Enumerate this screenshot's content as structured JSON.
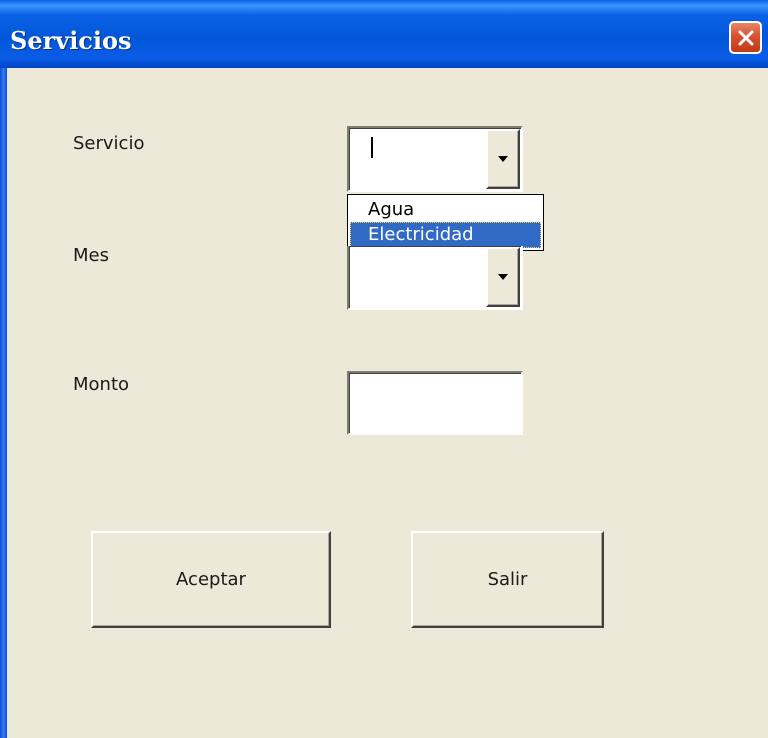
{
  "window": {
    "title": "Servicios",
    "close_icon": "close-icon",
    "accent": "#0a5fe8",
    "close_color": "#d8522e"
  },
  "form": {
    "servicio_label": "Servicio",
    "servicio_value": "",
    "servicio_options": [
      "Agua",
      "Electricidad"
    ],
    "servicio_highlighted": "Electricidad",
    "mes_label": "Mes",
    "mes_value": "",
    "monto_label": "Monto",
    "monto_value": ""
  },
  "buttons": {
    "accept_label": "Aceptar",
    "exit_label": "Salir"
  },
  "colors": {
    "background": "#ece9d8",
    "selection": "#316ac5"
  }
}
